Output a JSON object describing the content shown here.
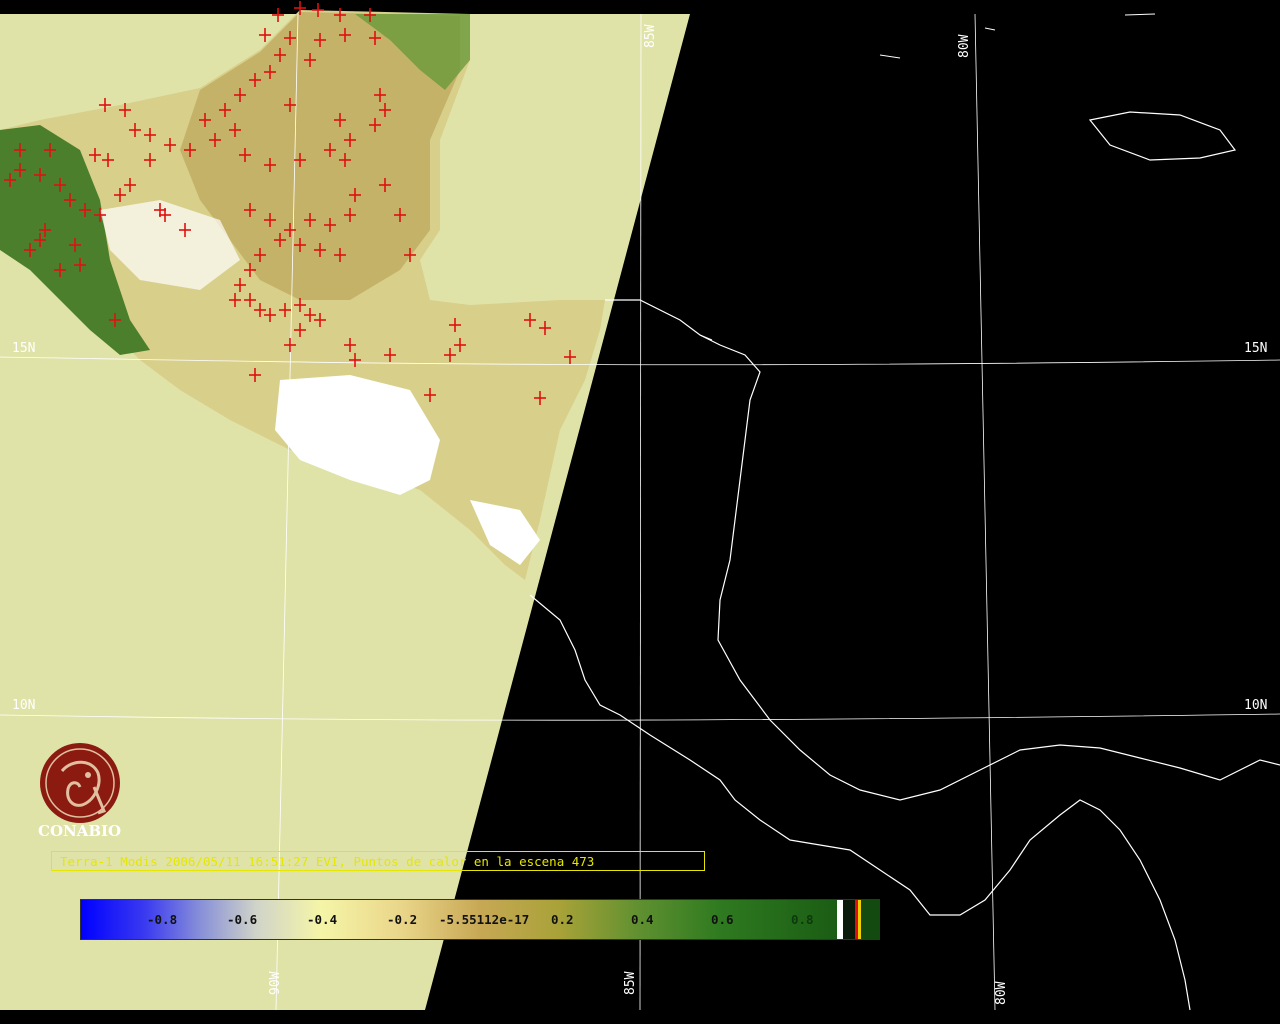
{
  "map": {
    "lat_labels": [
      {
        "text": "15N",
        "side": "left"
      },
      {
        "text": "15N",
        "side": "right"
      },
      {
        "text": "10N",
        "side": "left"
      },
      {
        "text": "10N",
        "side": "right"
      }
    ],
    "lon_labels": [
      {
        "text": "85W",
        "position": "top"
      },
      {
        "text": "80W",
        "position": "top"
      },
      {
        "text": "90W",
        "position": "bottom"
      },
      {
        "text": "85W",
        "position": "bottom"
      },
      {
        "text": "80W",
        "position": "bottom"
      }
    ],
    "hotspot_marker": "+",
    "hotspot_color": "#e01010",
    "land_color_outside_swath": "#e0e3a8",
    "background_color": "#000000",
    "coastline_color": "#ffffff"
  },
  "logo": {
    "name": "CONABIO",
    "icon": "conabio-logo-icon",
    "color": "#8b1a10"
  },
  "caption": {
    "text": "Terra-1 Modis 2006/05/11 16:51:27 EVI, Puntos de calor en la escena 473",
    "color": "#e6e600"
  },
  "colorbar": {
    "ticks": [
      "-0.8",
      "-0.6",
      "-0.4",
      "-0.2",
      "-5.55112e-17",
      "0.2",
      "0.4",
      "0.6",
      "0.8"
    ],
    "min_color": "#0000ff",
    "max_color": "#124a10"
  }
}
